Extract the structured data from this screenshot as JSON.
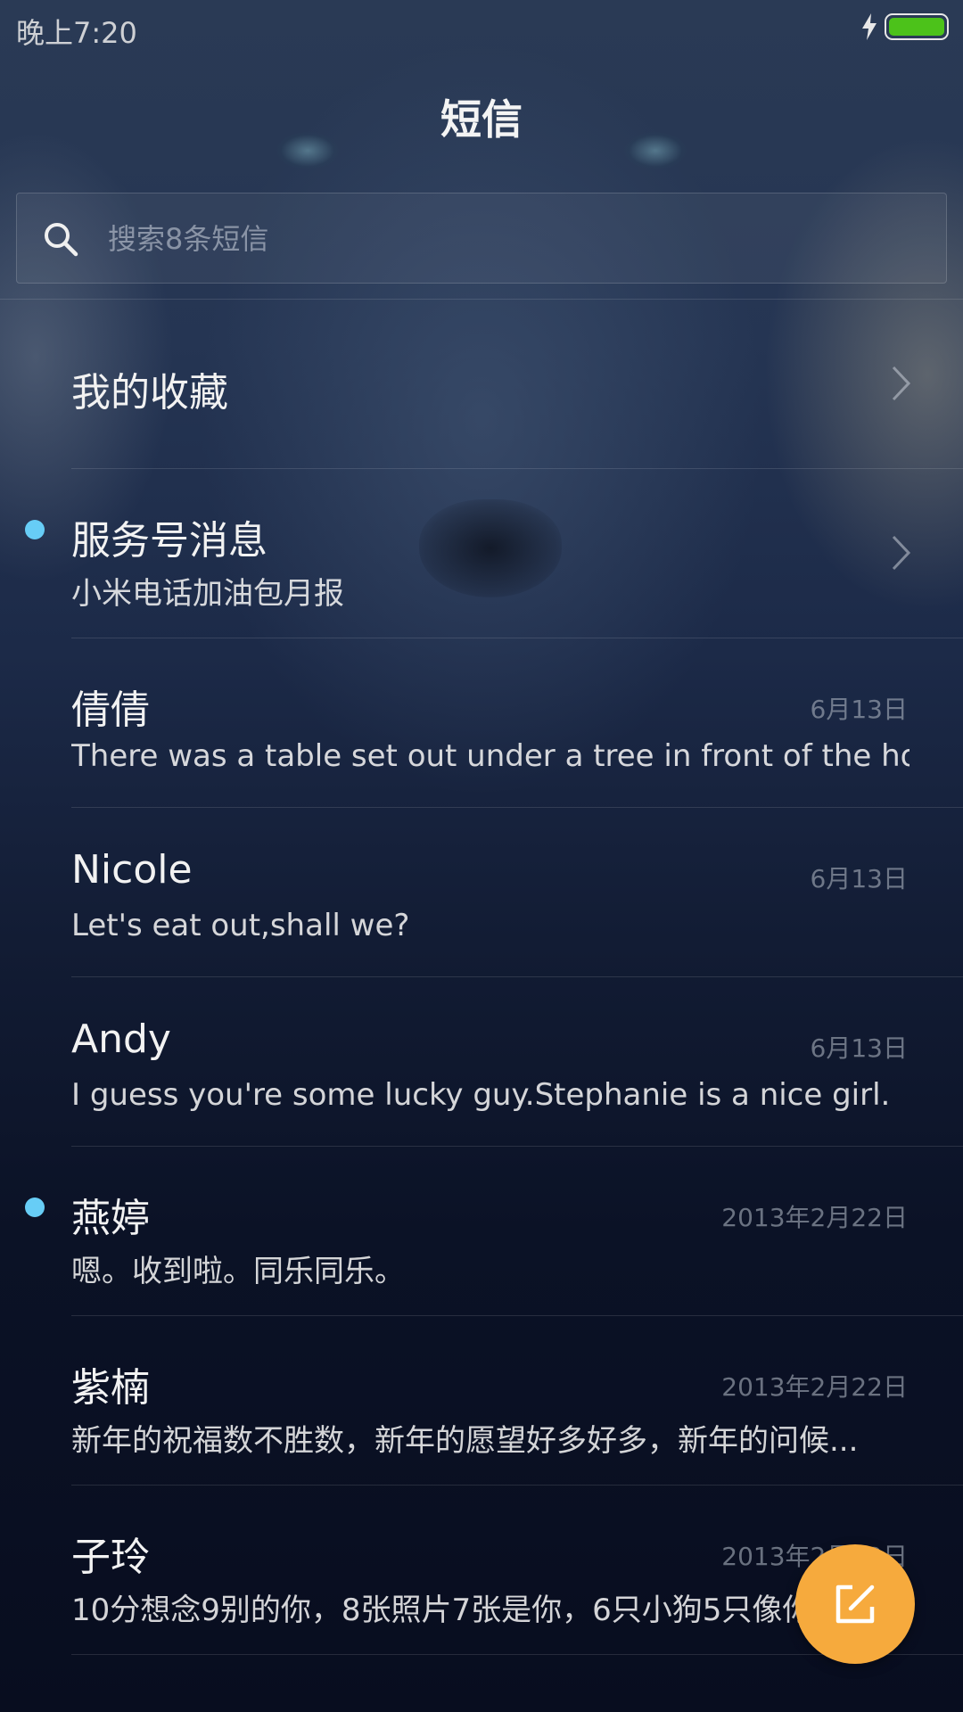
{
  "status_bar": {
    "time": "晚上7:20"
  },
  "header": {
    "title": "短信"
  },
  "search": {
    "placeholder": "搜索8条短信"
  },
  "favorites": {
    "label": "我的收藏"
  },
  "service": {
    "name": "服务号消息",
    "preview": "小米电话加油包月报",
    "unread": true
  },
  "conversations": [
    {
      "name": "倩倩",
      "date": "6月13日",
      "preview": "There was a table set out under a tree in front of the ho...",
      "unread": false
    },
    {
      "name": "Nicole",
      "date": "6月13日",
      "preview": "Let's eat out,shall we?",
      "unread": false
    },
    {
      "name": "Andy",
      "date": "6月13日",
      "preview": "I guess you're some lucky guy.Stephanie is a nice girl.",
      "unread": false
    },
    {
      "name": "燕婷",
      "date": "2013年2月22日",
      "preview": "嗯。收到啦。同乐同乐。",
      "unread": true
    },
    {
      "name": "紫楠",
      "date": "2013年2月22日",
      "preview": "新年的祝福数不胜数，新年的愿望好多好多，新年的问候...",
      "unread": false
    },
    {
      "name": "子玲",
      "date": "2013年2月22日",
      "preview": "10分想念9别的你，8张照片7张是你，6只小狗5只像你",
      "unread": false
    }
  ],
  "colors": {
    "unread_dot": "#67cdf6",
    "fab": "#f6aa3d",
    "battery": "#4cc21a"
  },
  "icons": {
    "search": "search-icon",
    "chevron": "chevron-right-icon",
    "compose": "compose-icon",
    "charging": "charging-icon",
    "battery": "battery-icon"
  }
}
